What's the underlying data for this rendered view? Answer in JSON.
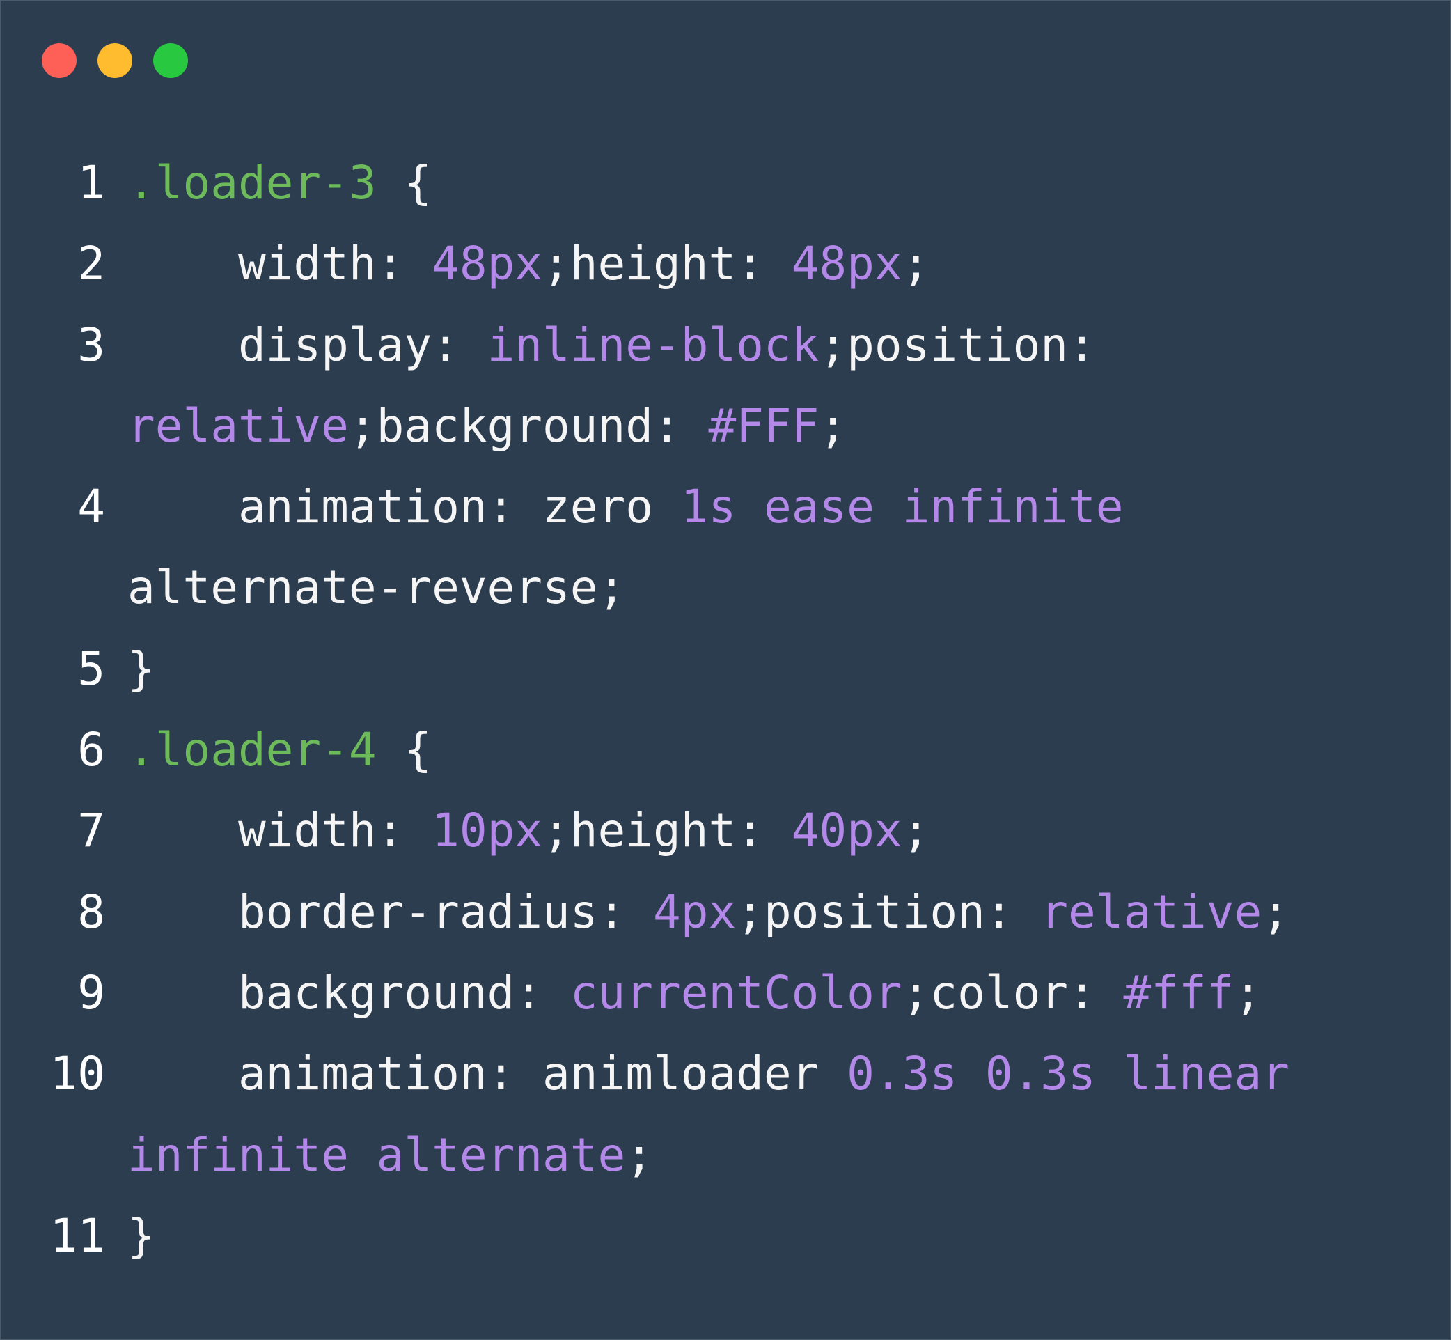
{
  "window": {
    "controls": [
      "close",
      "minimize",
      "maximize"
    ],
    "colors": {
      "background": "#2c3d50",
      "close": "#fe5f57",
      "minimize": "#febc2e",
      "maximize": "#28c840",
      "selector": "#6dba5b",
      "value": "#b388e8",
      "text": "#f5f5f5"
    }
  },
  "code": {
    "lines": [
      {
        "num": "1",
        "tokens": [
          {
            "t": ".loader-3",
            "k": "sel"
          },
          {
            "t": " {",
            "k": "plain"
          }
        ]
      },
      {
        "num": "2",
        "tokens": [
          {
            "t": "    width: ",
            "k": "plain"
          },
          {
            "t": "48px",
            "k": "val"
          },
          {
            "t": ";height: ",
            "k": "plain"
          },
          {
            "t": "48px",
            "k": "val"
          },
          {
            "t": ";",
            "k": "plain"
          }
        ]
      },
      {
        "num": "3",
        "tokens": [
          {
            "t": "    display: ",
            "k": "plain"
          },
          {
            "t": "inline-block",
            "k": "val"
          },
          {
            "t": ";position:",
            "k": "plain"
          }
        ]
      },
      {
        "num": "",
        "tokens": [
          {
            "t": "relative",
            "k": "val"
          },
          {
            "t": ";background: ",
            "k": "plain"
          },
          {
            "t": "#FFF",
            "k": "val"
          },
          {
            "t": ";",
            "k": "plain"
          }
        ]
      },
      {
        "num": "4",
        "tokens": [
          {
            "t": "    animation: zero ",
            "k": "plain"
          },
          {
            "t": "1s",
            "k": "val"
          },
          {
            "t": " ",
            "k": "plain"
          },
          {
            "t": "ease",
            "k": "val"
          },
          {
            "t": " ",
            "k": "plain"
          },
          {
            "t": "infinite",
            "k": "val"
          }
        ]
      },
      {
        "num": "",
        "tokens": [
          {
            "t": "alternate-reverse;",
            "k": "plain"
          }
        ]
      },
      {
        "num": "5",
        "tokens": [
          {
            "t": "}",
            "k": "plain"
          }
        ]
      },
      {
        "num": "6",
        "tokens": [
          {
            "t": ".loader-4",
            "k": "sel"
          },
          {
            "t": " {",
            "k": "plain"
          }
        ]
      },
      {
        "num": "7",
        "tokens": [
          {
            "t": "    width: ",
            "k": "plain"
          },
          {
            "t": "10px",
            "k": "val"
          },
          {
            "t": ";height: ",
            "k": "plain"
          },
          {
            "t": "40px",
            "k": "val"
          },
          {
            "t": ";",
            "k": "plain"
          }
        ]
      },
      {
        "num": "8",
        "tokens": [
          {
            "t": "    border-radius: ",
            "k": "plain"
          },
          {
            "t": "4px",
            "k": "val"
          },
          {
            "t": ";position: ",
            "k": "plain"
          },
          {
            "t": "relative",
            "k": "val"
          },
          {
            "t": ";",
            "k": "plain"
          }
        ]
      },
      {
        "num": "9",
        "tokens": [
          {
            "t": "    background: ",
            "k": "plain"
          },
          {
            "t": "currentColor",
            "k": "val"
          },
          {
            "t": ";color: ",
            "k": "plain"
          },
          {
            "t": "#fff",
            "k": "val"
          },
          {
            "t": ";",
            "k": "plain"
          }
        ]
      },
      {
        "num": "10",
        "tokens": [
          {
            "t": "    animation: animloader ",
            "k": "plain"
          },
          {
            "t": "0.3s",
            "k": "val"
          },
          {
            "t": " ",
            "k": "plain"
          },
          {
            "t": "0.3s",
            "k": "val"
          },
          {
            "t": " ",
            "k": "plain"
          },
          {
            "t": "linear",
            "k": "val"
          }
        ]
      },
      {
        "num": "",
        "tokens": [
          {
            "t": "infinite",
            "k": "val"
          },
          {
            "t": " ",
            "k": "plain"
          },
          {
            "t": "alternate",
            "k": "val"
          },
          {
            "t": ";",
            "k": "plain"
          }
        ]
      },
      {
        "num": "11",
        "tokens": [
          {
            "t": "}",
            "k": "plain"
          }
        ]
      }
    ]
  }
}
